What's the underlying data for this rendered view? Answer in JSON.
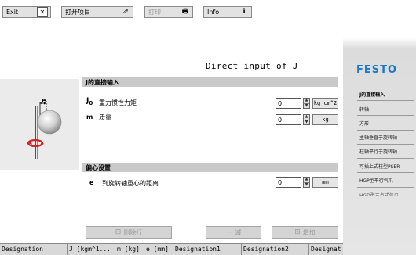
{
  "toolbar": {
    "exit_label": "Exit",
    "open_project_label": "打开项目",
    "print_label": "打印",
    "info_label": "Info"
  },
  "main": {
    "title": "Direct input of J",
    "section1_title": "J的直接输入",
    "j0_symbol": "J",
    "j0_sub": "0",
    "j0_label": "重力惯性力矩",
    "j0_value": "0",
    "j0_unit": "kg cm^2",
    "m_symbol": "m",
    "m_label": "质量",
    "m_value": "0",
    "m_unit": "kg",
    "section2_title": "偏心设置",
    "e_symbol": "e",
    "e_label": "到旋转轴重心的距离",
    "e_value": "0",
    "e_unit": "mm",
    "diagram_e_label": "e"
  },
  "actions": {
    "delete_row_label": "删除行",
    "minus_label": "减",
    "add_label": "增加"
  },
  "table": {
    "columns": [
      "Designation",
      "J [kgm^1...",
      "m [kg]",
      "e [mm]",
      "Designation1",
      "Designation2",
      "Designat"
    ]
  },
  "sidebar": {
    "brand": "FESTO",
    "items": [
      {
        "label": "J的直接输入",
        "active": true
      },
      {
        "label": "转轴",
        "active": false
      },
      {
        "label": "方形",
        "active": false
      },
      {
        "label": "主轴垂直于旋转轴",
        "active": false
      },
      {
        "label": "柱轴平行于旋转轴",
        "active": false
      },
      {
        "label": "可插上式柱型PSER",
        "active": false
      },
      {
        "label": "HGP型平行气爪",
        "active": false
      },
      {
        "label": "HGD型三点式气爪",
        "active": false
      }
    ]
  }
}
